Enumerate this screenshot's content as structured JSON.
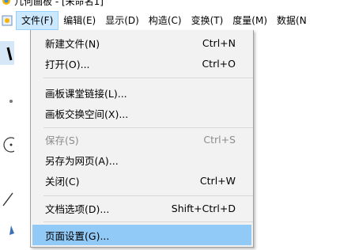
{
  "window": {
    "title": "几何画板 - [未命名1]"
  },
  "menubar": {
    "items": [
      {
        "label": "文件(F)",
        "active": true
      },
      {
        "label": "编辑(E)"
      },
      {
        "label": "显示(D)"
      },
      {
        "label": "构造(C)"
      },
      {
        "label": "变换(T)"
      },
      {
        "label": "度量(M)"
      },
      {
        "label": "数据(N"
      }
    ]
  },
  "file_menu": {
    "items": [
      {
        "label": "新建文件(N)",
        "shortcut": "Ctrl+N"
      },
      {
        "label": "打开(O)...",
        "shortcut": "Ctrl+O"
      },
      {
        "label": "画板课堂链接(L)...",
        "shortcut": ""
      },
      {
        "label": "画板交换空间(X)...",
        "shortcut": ""
      },
      {
        "label": "保存(S)",
        "shortcut": "Ctrl+S",
        "disabled": true
      },
      {
        "label": "另存为网页(A)...",
        "shortcut": ""
      },
      {
        "label": "关闭(C)",
        "shortcut": "Ctrl+W"
      },
      {
        "label": "文档选项(D)...",
        "shortcut": "Shift+Ctrl+D"
      },
      {
        "label": "页面设置(G)...",
        "shortcut": "",
        "highlighted": true
      }
    ]
  },
  "colors": {
    "menu_bg": "#f2f2f2",
    "highlight": "#91c9f7",
    "active_menu": "#cce8ff",
    "disabled_text": "#8c8c8c"
  }
}
